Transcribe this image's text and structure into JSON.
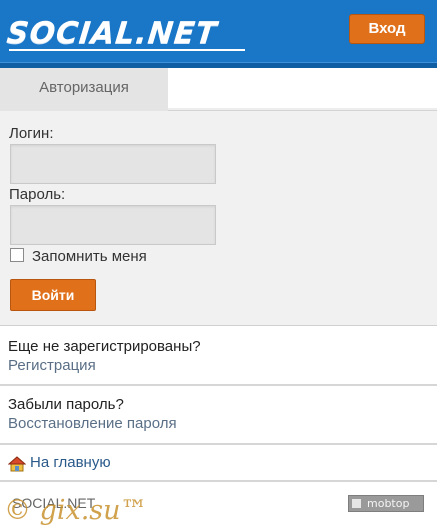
{
  "header": {
    "logo": "SOCIAL.NET",
    "login_button": "Вход"
  },
  "tabs": {
    "active": "Авторизация"
  },
  "form": {
    "login_label": "Логин:",
    "login_value": "",
    "password_label": "Пароль:",
    "password_value": "",
    "remember_label": "Запомнить меня",
    "remember_checked": false,
    "submit_label": "Войти"
  },
  "register": {
    "question": "Еще не зарегистрированы?",
    "link": "Регистрация"
  },
  "forgot": {
    "question": "Забыли пароль?",
    "link": "Восстановление пароля"
  },
  "home": {
    "icon": "home-icon",
    "label": "На главную"
  },
  "footer": {
    "brand": "SOCIAL.NET",
    "counter_label": "mobtop"
  },
  "watermark": "© gix.su™",
  "colors": {
    "header_blue": "#1a76c6",
    "accent_orange": "#e0701a",
    "link_gray_blue": "#5a6f86"
  }
}
